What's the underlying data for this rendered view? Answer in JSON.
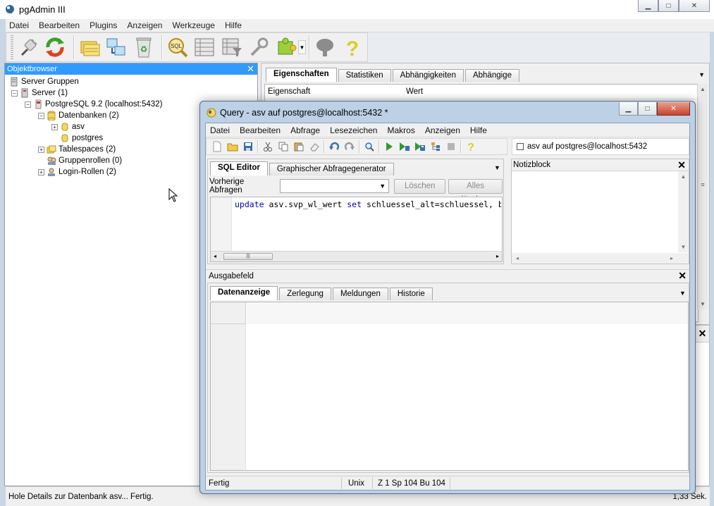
{
  "main_window": {
    "title": "pgAdmin III",
    "menu": [
      "Datei",
      "Bearbeiten",
      "Plugins",
      "Anzeigen",
      "Werkzeuge",
      "Hilfe"
    ],
    "toolbar_icons": [
      "plug-icon",
      "refresh-icon",
      "folders-icon",
      "arrange-icon",
      "recycle-icon",
      "sql-icon",
      "table-icon",
      "filtered-table-icon",
      "wrench-icon",
      "puzzle-icon",
      "dropdown-arrow-icon",
      "elephant-icon",
      "help-icon"
    ],
    "status_left": "Hole Details zur Datenbank asv... Fertig.",
    "status_right": "1,33 Sek."
  },
  "object_browser": {
    "title": "Objektbrowser",
    "tree": [
      {
        "label": "Server Gruppen",
        "icon": "server-group-icon"
      },
      {
        "label": "Server (1)",
        "icon": "server-icon"
      },
      {
        "label": "PostgreSQL 9.2 (localhost:5432)",
        "icon": "postgres-server-icon"
      },
      {
        "label": "Datenbanken (2)",
        "icon": "databases-icon"
      },
      {
        "label": "asv",
        "icon": "database-icon"
      },
      {
        "label": "postgres",
        "icon": "database-icon"
      },
      {
        "label": "Tablespaces (2)",
        "icon": "tablespaces-icon"
      },
      {
        "label": "Gruppenrollen (0)",
        "icon": "group-roles-icon"
      },
      {
        "label": "Login-Rollen (2)",
        "icon": "login-roles-icon"
      }
    ]
  },
  "properties": {
    "tabs": [
      "Eigenschaften",
      "Statistiken",
      "Abhängigkeiten",
      "Abhängige"
    ],
    "active_tab": "Eigenschaften",
    "columns": [
      "Eigenschaft",
      "Wert"
    ]
  },
  "query_window": {
    "title": "Query - asv auf postgres@localhost:5432 *",
    "menu": [
      "Datei",
      "Bearbeiten",
      "Abfrage",
      "Lesezeichen",
      "Makros",
      "Anzeigen",
      "Hilfe"
    ],
    "connection": "asv auf postgres@localhost:5432",
    "editor_tabs": [
      "SQL Editor",
      "Graphischer Abfragegenerator"
    ],
    "previous_queries_label": "Vorherige Abfragen",
    "delete_button": "Löschen",
    "delete_all_button": "Alles löschen",
    "sql_keyword_1": "update",
    "sql_middle": " asv.svp_wl_wert ",
    "sql_keyword_2": "set",
    "sql_rest": " schluessel_alt=schluessel, b",
    "notepad_title": "Notizblock",
    "output_title": "Ausgabefeld",
    "output_tabs": [
      "Datenanzeige",
      "Zerlegung",
      "Meldungen",
      "Historie"
    ],
    "status": {
      "state": "Fertig",
      "line_ending": "Unix",
      "position": "Z 1 Sp 104 Bu 104"
    }
  },
  "colors": {
    "selection_blue": "#3399ff",
    "frame_blue": "#bcd0e6",
    "keyword_blue": "#0000c0"
  }
}
